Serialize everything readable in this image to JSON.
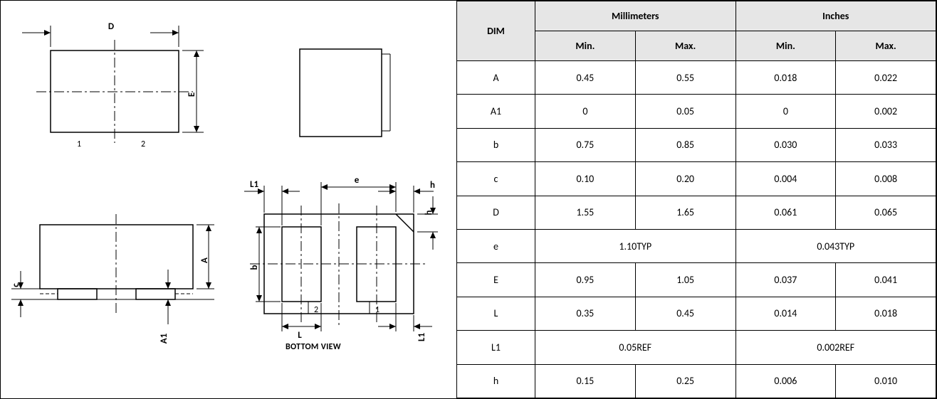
{
  "drawing": {
    "bottom_view_label": "BOTTOM VIEW",
    "dims": {
      "D": "D",
      "E": "E",
      "A": "A",
      "A1": "A1",
      "c": "c",
      "L": "L",
      "L1": "L1",
      "L1b": "L1",
      "b": "b",
      "e": "e",
      "h": "h",
      "hb": "h"
    },
    "pin_labels": {
      "one": "1",
      "two": "2",
      "one_b": "1",
      "two_b": "2"
    }
  },
  "table": {
    "headers": {
      "dim": "DIM",
      "mm": "Millimeters",
      "in": "Inches",
      "min": "Min.",
      "max": "Max."
    },
    "rows": [
      {
        "dim": "A",
        "mm_min": "0.45",
        "mm_max": "0.55",
        "in_min": "0.018",
        "in_max": "0.022"
      },
      {
        "dim": "A1",
        "mm_min": "0",
        "mm_max": "0.05",
        "in_min": "0",
        "in_max": "0.002"
      },
      {
        "dim": "b",
        "mm_min": "0.75",
        "mm_max": "0.85",
        "in_min": "0.030",
        "in_max": "0.033"
      },
      {
        "dim": "c",
        "mm_min": "0.10",
        "mm_max": "0.20",
        "in_min": "0.004",
        "in_max": "0.008"
      },
      {
        "dim": "D",
        "mm_min": "1.55",
        "mm_max": "1.65",
        "in_min": "0.061",
        "in_max": "0.065"
      },
      {
        "dim": "e",
        "mm_span": "1.10TYP",
        "in_span": "0.043TYP"
      },
      {
        "dim": "E",
        "mm_min": "0.95",
        "mm_max": "1.05",
        "in_min": "0.037",
        "in_max": "0.041"
      },
      {
        "dim": "L",
        "mm_min": "0.35",
        "mm_max": "0.45",
        "in_min": "0.014",
        "in_max": "0.018"
      },
      {
        "dim": "L1",
        "mm_span": "0.05REF",
        "in_span": "0.002REF"
      },
      {
        "dim": "h",
        "mm_min": "0.15",
        "mm_max": "0.25",
        "in_min": "0.006",
        "in_max": "0.010"
      }
    ]
  }
}
